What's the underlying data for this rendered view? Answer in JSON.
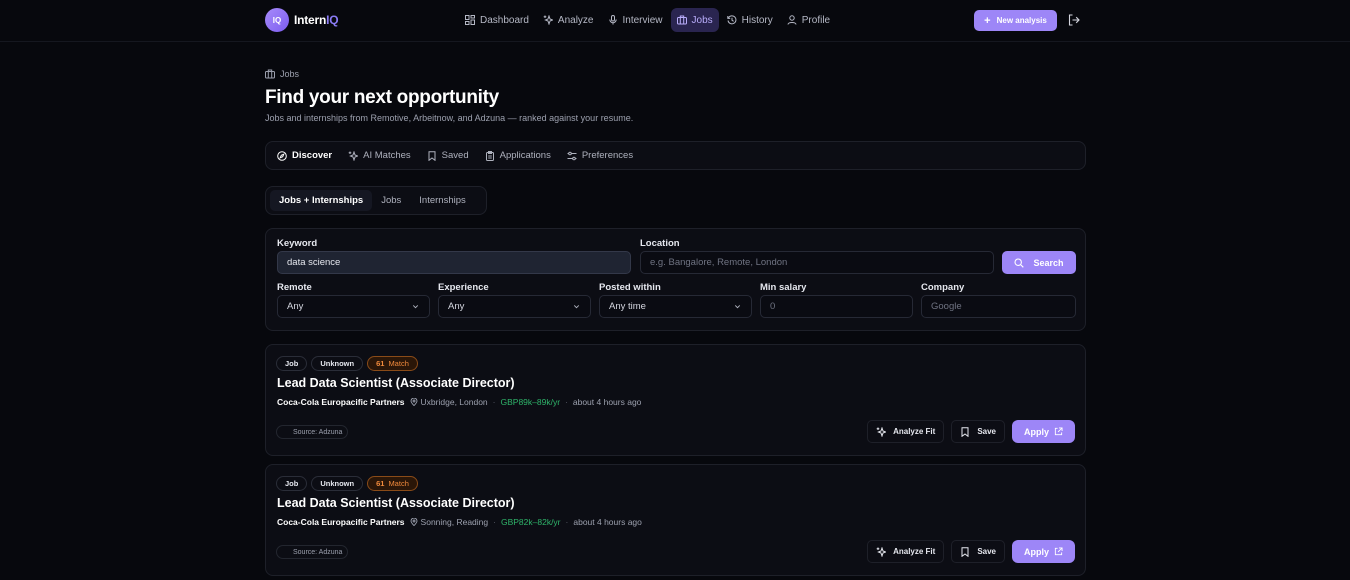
{
  "brand": {
    "logo_text": "IQ",
    "name_a": "Intern",
    "name_b": "IQ"
  },
  "nav": {
    "links": [
      {
        "label": "Dashboard",
        "icon": "grid-icon"
      },
      {
        "label": "Analyze",
        "icon": "sparkles-icon"
      },
      {
        "label": "Interview",
        "icon": "mic-icon"
      },
      {
        "label": "Jobs",
        "icon": "briefcase-icon",
        "active": true
      },
      {
        "label": "History",
        "icon": "history-icon"
      },
      {
        "label": "Profile",
        "icon": "user-icon"
      }
    ],
    "new_analysis": "New analysis",
    "logout_icon": "logout-icon"
  },
  "page": {
    "breadcrumb": "Jobs",
    "title": "Find your next opportunity",
    "subtitle": "Jobs and internships from Remotive, Arbeitnow, and Adzuna — ranked against your resume."
  },
  "tabs": [
    {
      "label": "Discover",
      "icon": "compass-icon",
      "active": true
    },
    {
      "label": "AI Matches",
      "icon": "sparkles-icon"
    },
    {
      "label": "Saved",
      "icon": "bookmark-icon"
    },
    {
      "label": "Applications",
      "icon": "clipboard-icon"
    },
    {
      "label": "Preferences",
      "icon": "sliders-icon"
    }
  ],
  "segments": [
    {
      "label": "Jobs + Internships",
      "active": true
    },
    {
      "label": "Jobs"
    },
    {
      "label": "Internships"
    }
  ],
  "search": {
    "keyword_label": "Keyword",
    "keyword_value": "data science",
    "location_label": "Location",
    "location_placeholder": "e.g. Bangalore, Remote, London",
    "search_button": "Search",
    "remote_label": "Remote",
    "remote_value": "Any",
    "experience_label": "Experience",
    "experience_value": "Any",
    "posted_label": "Posted within",
    "posted_value": "Any time",
    "salary_label": "Min salary",
    "salary_placeholder": "0",
    "company_label": "Company",
    "company_placeholder": "Google"
  },
  "jobs": [
    {
      "type": "Job",
      "mode": "Unknown",
      "match_score": "61",
      "match_label": "Match",
      "title": "Lead Data Scientist (Associate Director)",
      "company": "Coca-Cola Europacific Partners",
      "location": "Uxbridge, London",
      "salary": "GBP89k–89k/yr",
      "posted": "about 4 hours ago",
      "source": "Source: Adzuna",
      "analyze": "Analyze Fit",
      "save": "Save",
      "apply": "Apply"
    },
    {
      "type": "Job",
      "mode": "Unknown",
      "match_score": "61",
      "match_label": "Match",
      "title": "Lead Data Scientist (Associate Director)",
      "company": "Coca-Cola Europacific Partners",
      "location": "Sonning, Reading",
      "salary": "GBP82k–82k/yr",
      "posted": "about 4 hours ago",
      "source": "Source: Adzuna",
      "analyze": "Analyze Fit",
      "save": "Save",
      "apply": "Apply"
    }
  ],
  "colors": {
    "accent": "#9d86f7",
    "active_nav_bg": "#2a2550",
    "match": "#f08a3c",
    "salary": "#2fb46a",
    "background": "#07080d"
  }
}
